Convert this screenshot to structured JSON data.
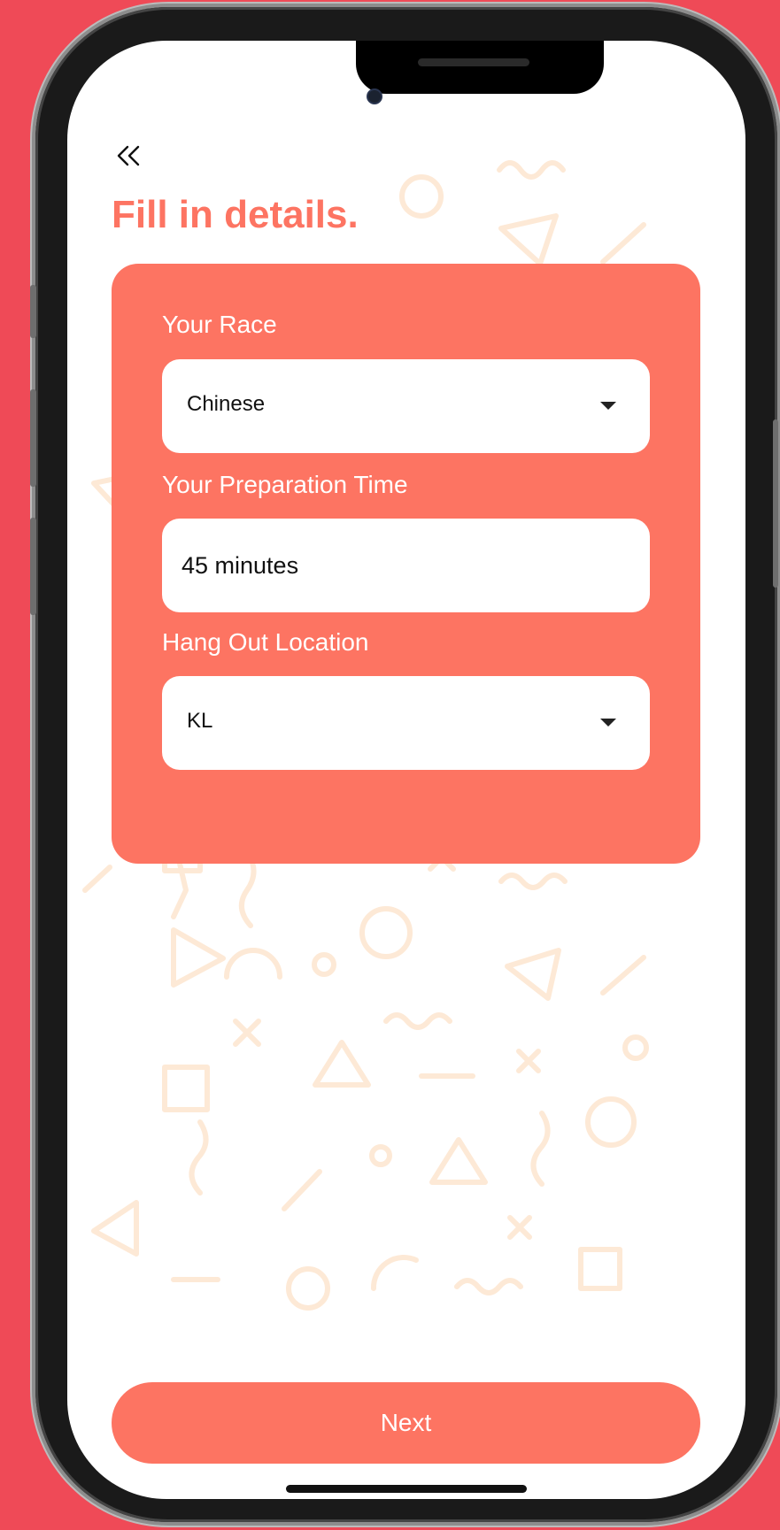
{
  "header": {
    "back_icon": "double-chevron-left-icon",
    "title": "Fill in details."
  },
  "form": {
    "race": {
      "label": "Your Race",
      "value": "Chinese",
      "icon": "caret-down-icon"
    },
    "prep_time": {
      "label": "Your Preparation Time",
      "value": "45 minutes"
    },
    "location": {
      "label": "Hang Out Location",
      "value": "KL",
      "icon": "caret-down-icon"
    }
  },
  "footer": {
    "next_label": "Next"
  },
  "colors": {
    "background": "#ef4a57",
    "accent": "#fd7462",
    "pattern": "#fde9d6"
  }
}
